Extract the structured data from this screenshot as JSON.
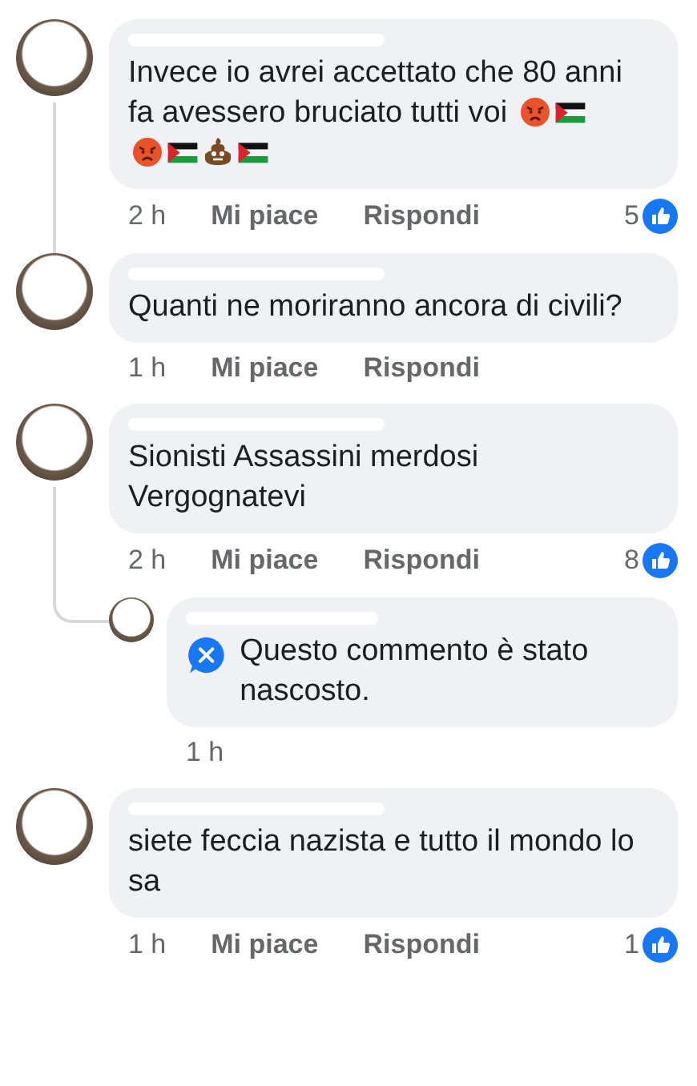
{
  "comments": [
    {
      "text": "Invece io avrei accettato che 80 anni fa avessero bruciato tutti voi",
      "emojis": [
        {
          "kind": "angry"
        },
        {
          "kind": "flag"
        },
        {
          "kind": "break"
        },
        {
          "kind": "angry"
        },
        {
          "kind": "flag"
        },
        {
          "kind": "poop"
        },
        {
          "kind": "flag"
        }
      ],
      "time": "2 h",
      "like": "Mi piace",
      "reply": "Rispondi",
      "likes": "5",
      "thread_continues": true
    },
    {
      "text": "Quanti ne moriranno ancora di civili?",
      "time": "1 h",
      "like": "Mi piace",
      "reply": "Rispondi",
      "thread_continues": false
    },
    {
      "text": "Sionisti Assassini merdosi Vergognatevi",
      "time": "2 h",
      "like": "Mi piace",
      "reply": "Rispondi",
      "likes": "8",
      "thread_continues": true,
      "replies": [
        {
          "hidden_notice": "Questo commento è stato nascosto.",
          "time": "1 h"
        }
      ]
    },
    {
      "text": "siete feccia nazista e tutto il mondo lo sa",
      "time": "1 h",
      "like": "Mi piace",
      "reply": "Rispondi",
      "likes": "1",
      "thread_continues": false
    }
  ]
}
